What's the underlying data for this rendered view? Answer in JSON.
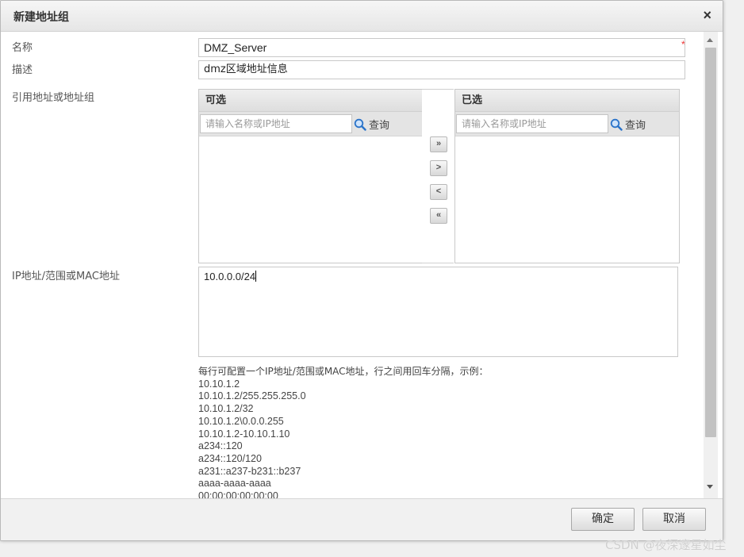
{
  "dialog": {
    "title": "新建地址组",
    "close_label": "×"
  },
  "form": {
    "name_label": "名称",
    "name_value": "DMZ_Server",
    "required_mark": "*",
    "desc_label": "描述",
    "desc_value": "dmz区域地址信息",
    "ref_label": "引用地址或地址组",
    "ip_label": "IP地址/范围或MAC地址",
    "ip_value": "10.0.0.0/24"
  },
  "selector": {
    "available_title": "可选",
    "selected_title": "已选",
    "search_placeholder": "请输入名称或IP地址",
    "query_label": "查询",
    "buttons": {
      "add_all": "»",
      "add": ">",
      "remove": "<",
      "remove_all": "«"
    }
  },
  "hint": {
    "title": "每行可配置一个IP地址/范围或MAC地址，行之间用回车分隔，示例：",
    "examples": [
      "10.10.1.2",
      "10.10.1.2/255.255.255.0",
      "10.10.1.2/32",
      "10.10.1.2\\0.0.0.255",
      "10.10.1.2-10.10.1.10",
      "a234::120",
      "a234::120/120",
      "a231::a237-b231::b237",
      "aaaa-aaaa-aaaa",
      "00:00:00:00:00:00"
    ]
  },
  "footer": {
    "ok_label": "确定",
    "cancel_label": "取消"
  },
  "watermark": "CSDN @夜深邃星如尘"
}
